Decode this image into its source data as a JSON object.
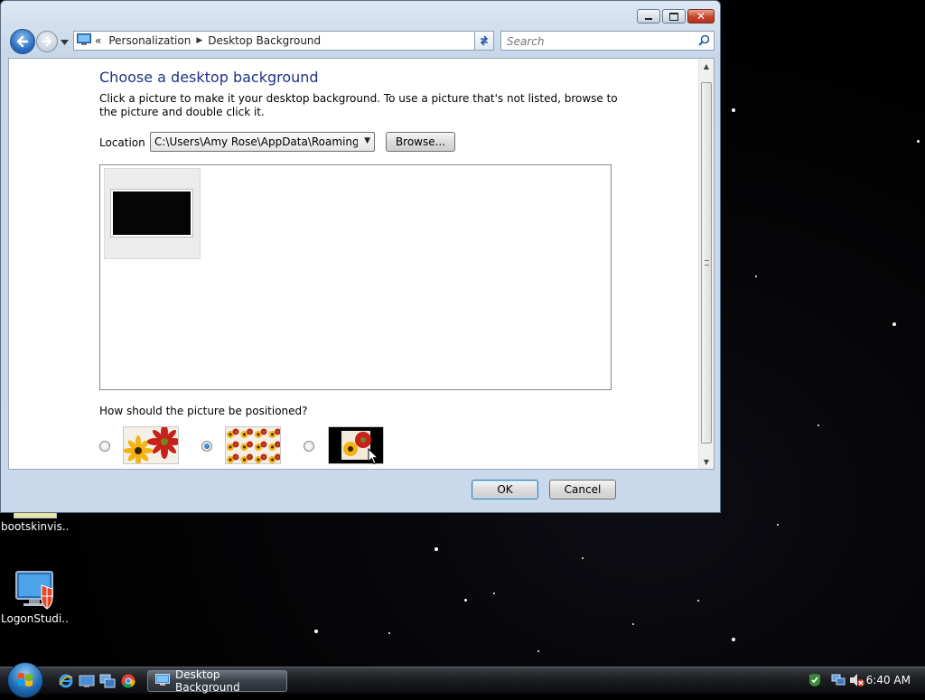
{
  "window": {
    "breadcrumb": [
      "Personalization",
      "Desktop Background"
    ],
    "overflow_chevron": "«",
    "search_placeholder": "Search"
  },
  "page": {
    "title": "Choose a desktop background",
    "description": "Click a picture to make it your desktop background. To use a picture that's not listed, browse to the picture and double click it.",
    "location_label": "Location",
    "location_value": "C:\\Users\\Amy Rose\\AppData\\Roaming\\Mi",
    "browse_label": "Browse...",
    "position_question": "How should the picture be positioned?",
    "position_options": [
      {
        "name": "fit-to-screen",
        "selected": false
      },
      {
        "name": "tile",
        "selected": true
      },
      {
        "name": "center",
        "selected": false
      }
    ]
  },
  "buttons": {
    "ok": "OK",
    "cancel": "Cancel"
  },
  "desktop_icons": [
    {
      "label": "bootskinvis...",
      "icon": "file-icon"
    },
    {
      "label": "LogonStudi...",
      "icon": "monitor-shield-icon"
    }
  ],
  "taskbar": {
    "active_window": "Desktop Background",
    "clock": "6:40 AM",
    "quick_launch": [
      "internet-explorer-icon",
      "show-desktop-icon",
      "switch-windows-icon",
      "chrome-icon"
    ]
  },
  "colors": {
    "accent": "#1e3287",
    "taskbar": "#1c1e22"
  }
}
